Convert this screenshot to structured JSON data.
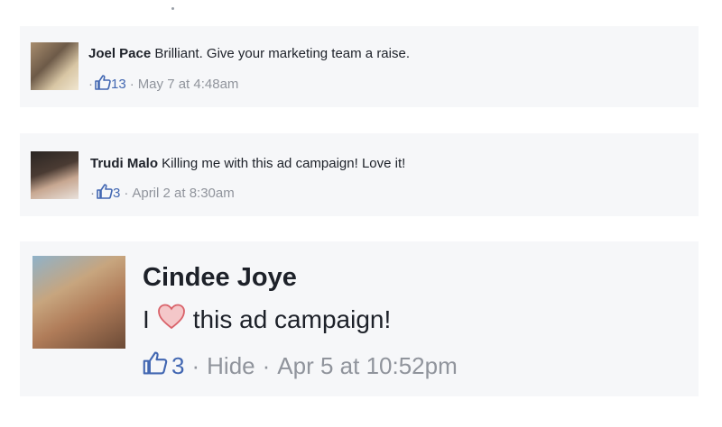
{
  "comments": [
    {
      "author": "Joel Pace",
      "text": "Brilliant. Give your marketing team a raise.",
      "likes": "13",
      "timestamp": "May 7 at 4:48am",
      "avatar_icon": "avatar-photo"
    },
    {
      "author": "Trudi Malo",
      "text": "Killing me with this ad campaign! Love it!",
      "likes": "3",
      "timestamp": "April 2 at 8:30am",
      "avatar_icon": "avatar-photo"
    },
    {
      "author": "Cindee Joye",
      "text_before": "I",
      "text_after": "this ad campaign!",
      "heart_icon": "heart-icon",
      "likes": "3",
      "hide_label": "Hide",
      "timestamp": "Apr 5 at 10:52pm",
      "avatar_icon": "avatar-photo"
    }
  ],
  "separator": "·",
  "colors": {
    "link": "#4267b2",
    "meta": "#90949c",
    "text": "#1d2129",
    "card": "#f6f7f9",
    "heart": "#e07a7f"
  }
}
